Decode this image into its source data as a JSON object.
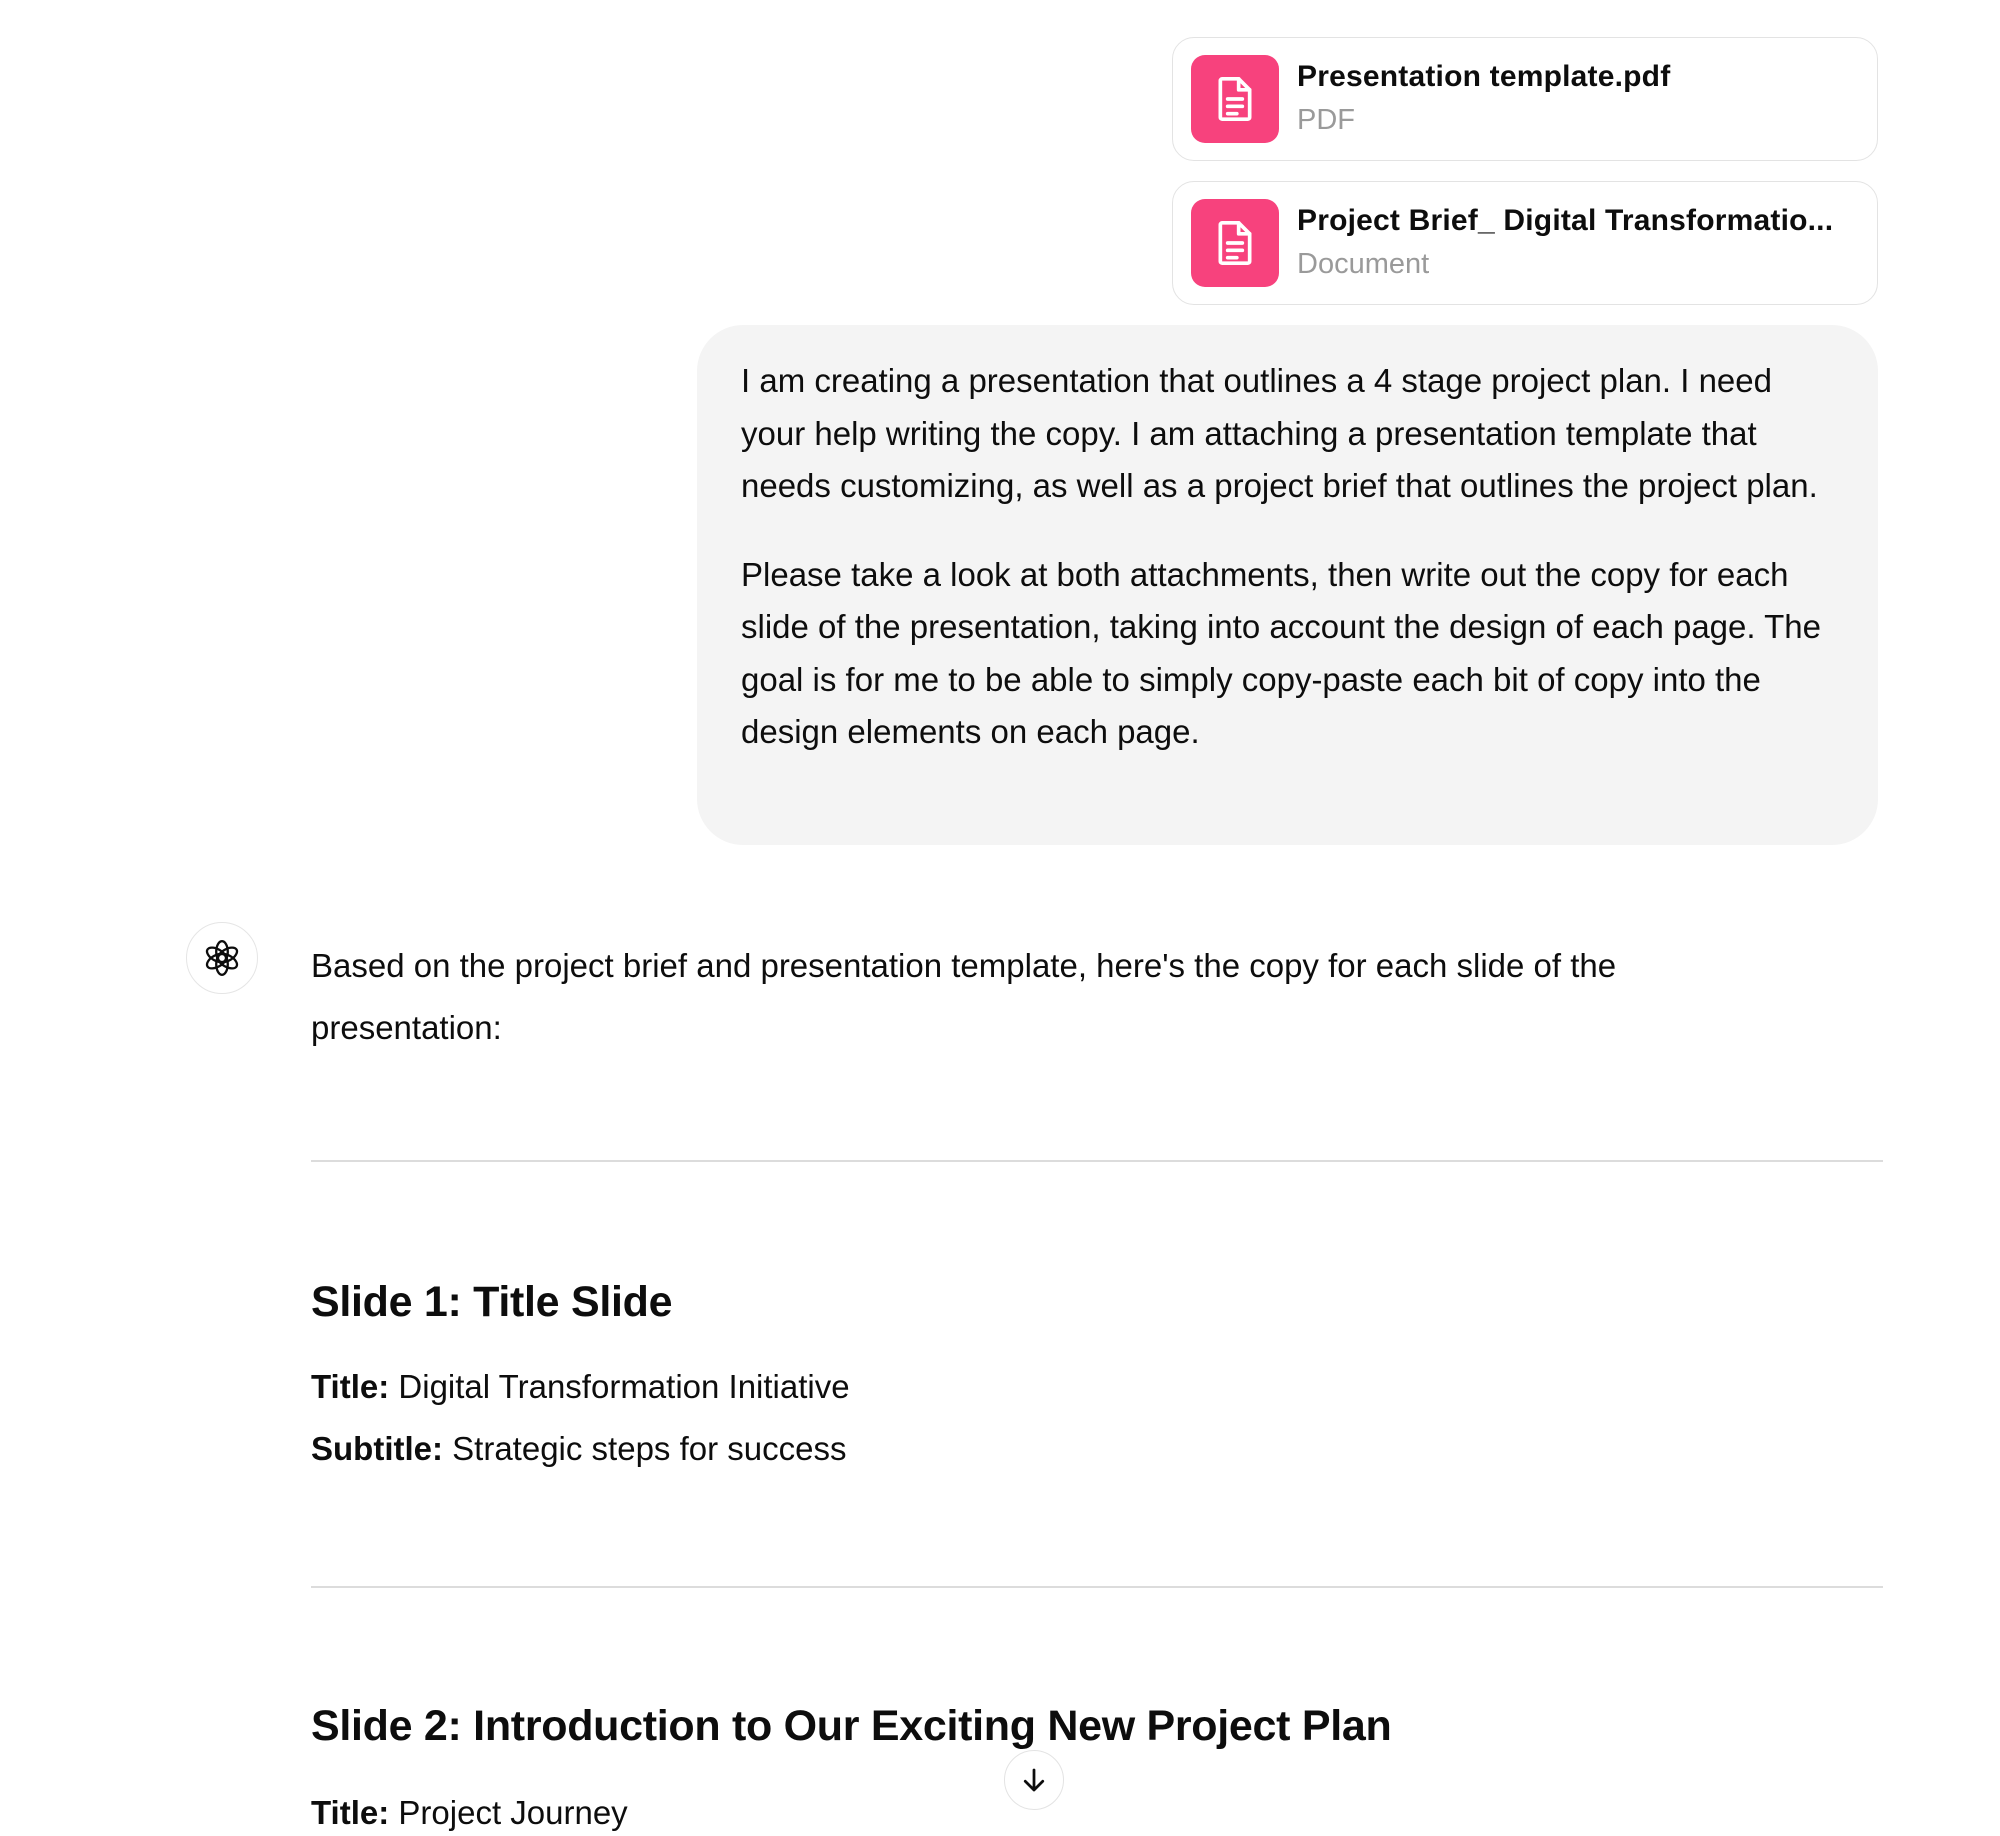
{
  "attachments": [
    {
      "name": "Presentation template.pdf",
      "type": "PDF",
      "icon": "document-icon"
    },
    {
      "name": "Project Brief_ Digital Transformatio...",
      "type": "Document",
      "icon": "document-icon"
    }
  ],
  "user_message": {
    "paragraphs": [
      "I am creating a presentation that outlines a 4 stage project plan. I need your help writing the copy. I am attaching a presentation template that needs customizing, as well as a project brief that outlines the project plan.",
      "Please take a look at both attachments, then write out the copy for each slide of the presentation, taking into account the design of each page. The goal is for me to be able to simply copy-paste each bit of copy into the design elements on each page."
    ]
  },
  "assistant": {
    "avatar_icon": "openai-logo-icon",
    "intro": "Based on the project brief and presentation template, here's the copy for each slide of the presentation:",
    "slides": [
      {
        "heading": "Slide 1: Title Slide",
        "fields": [
          {
            "label": "Title:",
            "value": "Digital Transformation Initiative"
          },
          {
            "label": "Subtitle:",
            "value": "Strategic steps for success"
          }
        ]
      },
      {
        "heading": "Slide 2: Introduction to Our Exciting New Project Plan",
        "fields": [
          {
            "label": "Title:",
            "value": "Project Journey"
          }
        ]
      }
    ]
  },
  "scroll_button": {
    "icon": "arrow-down-icon"
  },
  "colors": {
    "attachment_icon_bg": "#f7427d",
    "user_bubble_bg": "#f4f4f4",
    "divider": "#dcdcdc"
  }
}
